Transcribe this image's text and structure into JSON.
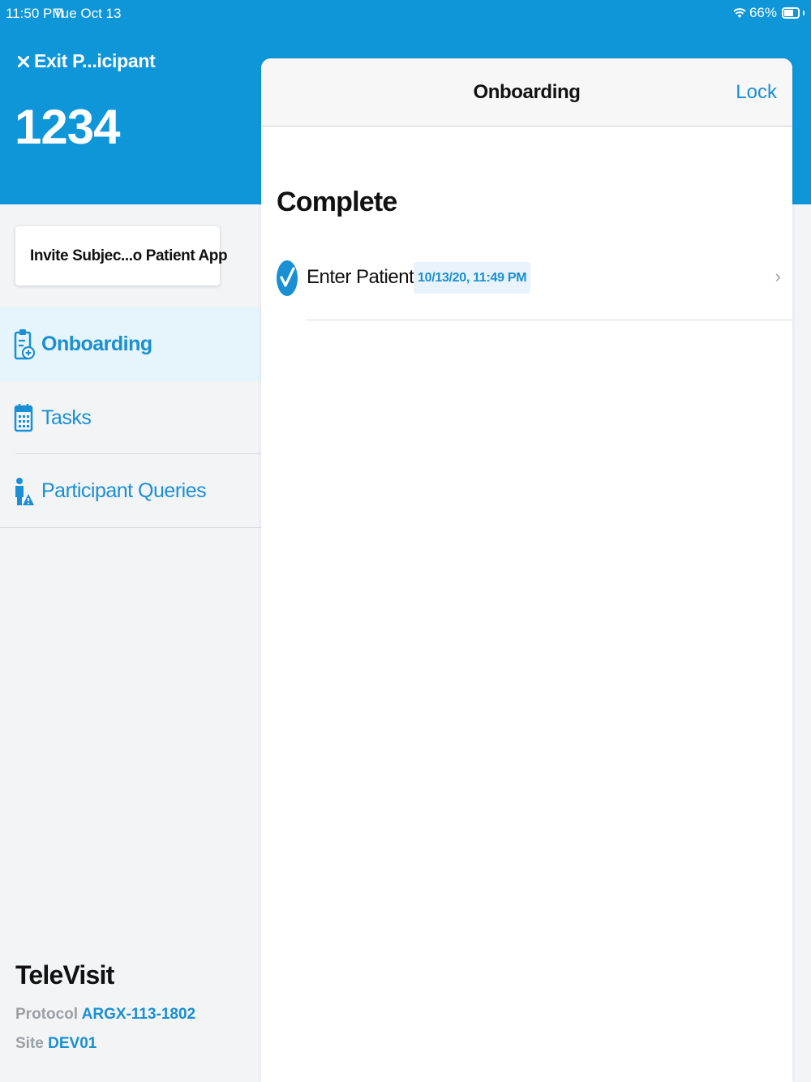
{
  "status_bar": {
    "time": "11:50 PM",
    "date": "Tue Oct 13",
    "battery": "66%",
    "battery_level": 0.66
  },
  "header": {
    "exit_label": "Exit P...icipant",
    "participant_id": "1234"
  },
  "invite_button": {
    "label": "Invite Subjec...o Patient App"
  },
  "nav": {
    "items": [
      {
        "label": "Onboarding",
        "icon": "clipboard-plus-icon",
        "active": true
      },
      {
        "label": "Tasks",
        "icon": "calendar-icon",
        "active": false
      },
      {
        "label": "Participant Queries",
        "icon": "person-alert-icon",
        "active": false
      }
    ]
  },
  "footer": {
    "app_name": "TeleVisit",
    "protocol_key": "Protocol",
    "protocol_value": "ARGX-113-1802",
    "site_key": "Site",
    "site_value": "DEV01"
  },
  "panel": {
    "title": "Onboarding",
    "lock_label": "Lock",
    "section_title": "Complete",
    "tasks": [
      {
        "name": "Enter Patient ID",
        "timestamp": "10/13/20, 11:49 PM",
        "status": "complete"
      }
    ]
  },
  "colors": {
    "header_blue": "#0f96d9",
    "accent": "#1a8fd3",
    "invite_icon_green": "#3bb54a"
  }
}
